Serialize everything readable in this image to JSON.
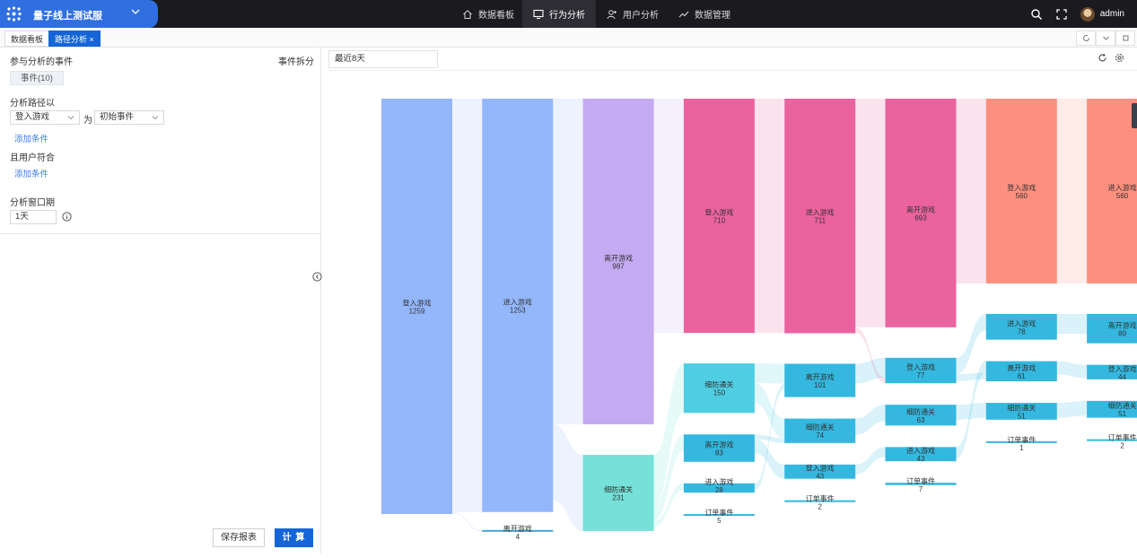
{
  "app": {
    "project_name": "量子线上测试服",
    "user_name": "admin"
  },
  "nav": [
    {
      "label": "数据看板",
      "icon": "home-icon"
    },
    {
      "label": "行为分析",
      "icon": "monitor-icon"
    },
    {
      "label": "用户分析",
      "icon": "user-add-icon"
    },
    {
      "label": "数据管理",
      "icon": "trend-icon"
    }
  ],
  "tabs": {
    "dashboard": "数据看板",
    "path_analysis": "路径分析 ×"
  },
  "left": {
    "events_label": "参与分析的事件",
    "split_label": "事件拆分",
    "events_pill": "事件(10)",
    "path_label": "分析路径以",
    "path_event": "登入游戏",
    "as_label": "为",
    "path_role": "初始事件",
    "add_condition": "添加条件",
    "user_match_label": "且用户符合",
    "add_condition_2": "添加条件",
    "window_label": "分析窗口期",
    "window_value": "1天",
    "save_button": "保存报表",
    "calc_button": "计 算"
  },
  "right": {
    "date_range": "最近8天"
  },
  "colors": {
    "accent": "#1565d8",
    "topbar": "#1b1b1f",
    "project": "#2f6fe0"
  },
  "chart_data": {
    "type": "sankey",
    "columns": [
      {
        "nodes": [
          {
            "label": "登入游戏",
            "value": 1259,
            "color": "#94b7fb"
          }
        ]
      },
      {
        "nodes": [
          {
            "label": "进入游戏",
            "value": 1253,
            "color": "#94b7fb"
          },
          {
            "label": "离开游戏",
            "value": 4,
            "color": "#3ea6dd"
          }
        ]
      },
      {
        "nodes": [
          {
            "label": "离开游戏",
            "value": 987,
            "color": "#c4aaf0"
          },
          {
            "label": "细防通关",
            "value": 231,
            "color": "#76e1d8"
          }
        ]
      },
      {
        "nodes": [
          {
            "label": "登入游戏",
            "value": 710,
            "color": "#ea639f"
          },
          {
            "label": "细防通关",
            "value": 150,
            "color": "#4fcde3"
          },
          {
            "label": "离开游戏",
            "value": 83,
            "color": "#34b8e0"
          },
          {
            "label": "进入游戏",
            "value": 28,
            "color": "#34b8e0"
          },
          {
            "label": "订单事件",
            "value": 5,
            "color": "#34b8e0"
          }
        ]
      },
      {
        "nodes": [
          {
            "label": "进入游戏",
            "value": 711,
            "color": "#ea639f"
          },
          {
            "label": "离开游戏",
            "value": 101,
            "color": "#34b8e0"
          },
          {
            "label": "细防通关",
            "value": 74,
            "color": "#34b8e0"
          },
          {
            "label": "登入游戏",
            "value": 43,
            "color": "#34b8e0"
          },
          {
            "label": "订单事件",
            "value": 2,
            "color": "#34b8e0"
          }
        ]
      },
      {
        "nodes": [
          {
            "label": "离开游戏",
            "value": 693,
            "color": "#ea639f"
          },
          {
            "label": "登入游戏",
            "value": 77,
            "color": "#34b8e0"
          },
          {
            "label": "细防通关",
            "value": 63,
            "color": "#34b8e0"
          },
          {
            "label": "进入游戏",
            "value": 43,
            "color": "#34b8e0"
          },
          {
            "label": "订单事件",
            "value": 7,
            "color": "#34b8e0"
          }
        ]
      },
      {
        "nodes": [
          {
            "label": "登入游戏",
            "value": 560,
            "color": "#fd8f7e"
          },
          {
            "label": "进入游戏",
            "value": 78,
            "color": "#34b8e0"
          },
          {
            "label": "离开游戏",
            "value": 61,
            "color": "#34b8e0"
          },
          {
            "label": "细防通关",
            "value": 51,
            "color": "#34b8e0"
          },
          {
            "label": "订单事件",
            "value": 1,
            "color": "#34b8e0"
          }
        ]
      },
      {
        "nodes": [
          {
            "label": "进入游戏",
            "value": 560,
            "color": "#fd8f7e"
          },
          {
            "label": "离开游戏",
            "value": 89,
            "color": "#34b8e0"
          },
          {
            "label": "登入游戏",
            "value": 44,
            "color": "#34b8e0"
          },
          {
            "label": "细防通关",
            "value": 51,
            "color": "#34b8e0"
          },
          {
            "label": "订单事件",
            "value": 2,
            "color": "#34b8e0"
          }
        ]
      }
    ],
    "links": [
      {
        "from": [
          0,
          0
        ],
        "to": [
          1,
          0
        ],
        "value": 1253
      },
      {
        "from": [
          0,
          0
        ],
        "to": [
          1,
          1
        ],
        "value": 4
      },
      {
        "from": [
          1,
          0
        ],
        "to": [
          2,
          0
        ],
        "value": 987
      },
      {
        "from": [
          1,
          0
        ],
        "to": [
          2,
          1
        ],
        "value": 231
      },
      {
        "from": [
          2,
          0
        ],
        "to": [
          3,
          0
        ],
        "value": 710
      },
      {
        "from": [
          2,
          1
        ],
        "to": [
          3,
          1
        ],
        "value": 150
      },
      {
        "from": [
          2,
          1
        ],
        "to": [
          3,
          2
        ],
        "value": 50
      },
      {
        "from": [
          2,
          1
        ],
        "to": [
          3,
          3
        ],
        "value": 20
      },
      {
        "from": [
          3,
          0
        ],
        "to": [
          4,
          0
        ],
        "value": 710
      },
      {
        "from": [
          3,
          1
        ],
        "to": [
          4,
          1
        ],
        "value": 60
      },
      {
        "from": [
          3,
          1
        ],
        "to": [
          4,
          2
        ],
        "value": 60
      },
      {
        "from": [
          3,
          2
        ],
        "to": [
          4,
          2
        ],
        "value": 14
      },
      {
        "from": [
          3,
          2
        ],
        "to": [
          4,
          3
        ],
        "value": 43
      },
      {
        "from": [
          3,
          3
        ],
        "to": [
          4,
          1
        ],
        "value": 20
      },
      {
        "from": [
          4,
          0
        ],
        "to": [
          5,
          0
        ],
        "value": 693
      },
      {
        "from": [
          4,
          1
        ],
        "to": [
          5,
          1
        ],
        "value": 60
      },
      {
        "from": [
          4,
          2
        ],
        "to": [
          5,
          2
        ],
        "value": 50
      },
      {
        "from": [
          4,
          3
        ],
        "to": [
          5,
          3
        ],
        "value": 30
      },
      {
        "from": [
          4,
          0
        ],
        "to": [
          5,
          1
        ],
        "value": 17
      },
      {
        "from": [
          5,
          0
        ],
        "to": [
          6,
          0
        ],
        "value": 560
      },
      {
        "from": [
          5,
          1
        ],
        "to": [
          6,
          1
        ],
        "value": 50
      },
      {
        "from": [
          5,
          2
        ],
        "to": [
          6,
          3
        ],
        "value": 45
      },
      {
        "from": [
          5,
          3
        ],
        "to": [
          6,
          2
        ],
        "value": 35
      },
      {
        "from": [
          5,
          1
        ],
        "to": [
          6,
          2
        ],
        "value": 20
      },
      {
        "from": [
          6,
          0
        ],
        "to": [
          7,
          0
        ],
        "value": 560
      },
      {
        "from": [
          6,
          1
        ],
        "to": [
          7,
          1
        ],
        "value": 60
      },
      {
        "from": [
          6,
          2
        ],
        "to": [
          7,
          2
        ],
        "value": 40
      },
      {
        "from": [
          6,
          3
        ],
        "to": [
          7,
          3
        ],
        "value": 45
      }
    ]
  }
}
